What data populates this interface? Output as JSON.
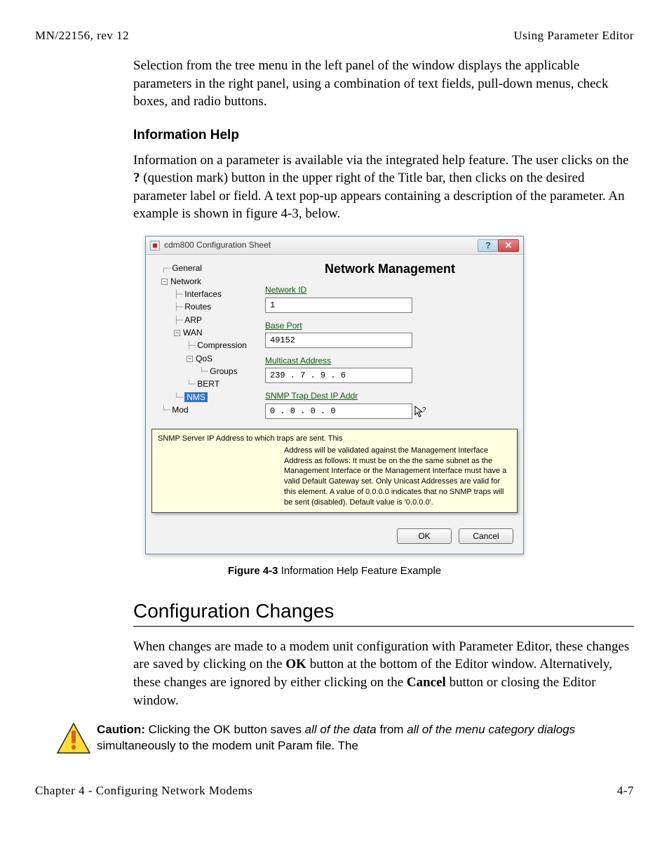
{
  "header": {
    "left": "MN/22156, rev 12",
    "right": "Using Parameter Editor"
  },
  "intro_para": "Selection from the tree menu in the left panel of the window displays the applicable parameters in the right panel, using a combination of text fields, pull-down menus, check boxes, and radio buttons.",
  "info_help": {
    "heading": "Information Help",
    "para_parts": {
      "a": "Information on a parameter is available via the integrated help feature. The user clicks on the ",
      "b": "?",
      "c": " (question mark) button in the upper right of the Title bar, then clicks on the desired parameter label or field. A text pop-up appears containing a description of the parameter. An example is shown in figure 4-3, below."
    }
  },
  "dialog": {
    "title": "cdm800 Configuration Sheet",
    "help_glyph": "?",
    "close_glyph": "✕",
    "tree": {
      "n0": "General",
      "n1": "Network",
      "n1a": "Interfaces",
      "n1b": "Routes",
      "n1c": "ARP",
      "n1d": "WAN",
      "n1d1": "Compression",
      "n1d2": "QoS",
      "n1d2a": "Groups",
      "n1d3": "BERT",
      "n1e": "NMS",
      "n2": "Mod",
      "minus": "−"
    },
    "panel": {
      "heading": "Network Management",
      "f1_label": "Network ID",
      "f1_value": "1",
      "f2_label": "Base Port",
      "f2_value": "49152",
      "f3_label": "Multicast Address",
      "f3_value": "239 . 7 . 9 . 6",
      "f4_label": "SNMP Trap Dest IP Addr",
      "f4_value": "0 . 0 . 0 . 0"
    },
    "tooltip": {
      "title": "SNMP Server IP Address to which traps are sent. This",
      "body": "Address will be validated against the Management Interface Address as follows: It must be on the the same subnet as the Management Interface or the Management Interface must have a valid Default Gateway set. Only Unicast Addresses are valid for this element. A value of 0.0.0.0 indicates that no SNMP traps will be sent (disabled). Default value is '0.0.0.0'."
    },
    "buttons": {
      "ok": "OK",
      "cancel": "Cancel"
    }
  },
  "figure": {
    "label": "Figure 4-3",
    "caption": "   Information Help Feature Example"
  },
  "config_changes": {
    "heading": "Configuration Changes",
    "para": {
      "a": "When changes are made to a modem unit configuration with Parameter Editor, these changes are saved by clicking on the ",
      "ok": "OK",
      "b": " button at the bottom of the Editor window. Alternatively, these changes are ignored by either clicking on the ",
      "cancel": "Cancel",
      "c": " button or closing the Editor window."
    }
  },
  "caution": {
    "label": "Caution:",
    "a": "  Clicking the OK button saves ",
    "i1": "all of the data",
    "b": " from ",
    "i2": "all of the menu category dialogs",
    "c": " simultaneously to the modem unit Param file. The"
  },
  "footer": {
    "left": "Chapter 4 - Configuring Network Modems",
    "right": "4-7"
  }
}
